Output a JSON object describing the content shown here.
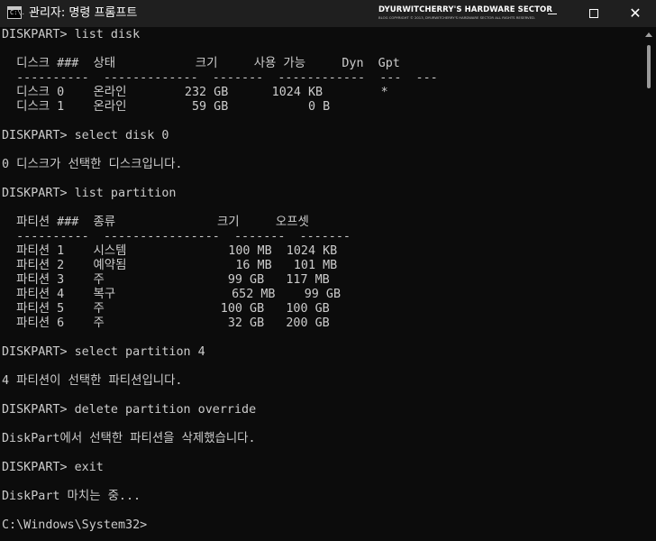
{
  "window": {
    "icon_label": "C:\\.",
    "title": "관리자: 명령 프롬프트",
    "watermark_title": "DYURWITCHERRY'S HARDWARE SECTOR",
    "watermark_sub": "BLOG COPYRIGHT © 2013, DYURWITCHERRY'S HARDWARE SECTOR ALL RIGHTS RESERVED."
  },
  "console": {
    "lines": [
      "DISKPART> list disk",
      "",
      "  디스크 ###  상태           크기     사용 가능     Dyn  Gpt",
      "  ----------  -------------  -------  ------------  ---  ---",
      "  디스크 0    온라인        232 GB      1024 KB        *",
      "  디스크 1    온라인         59 GB           0 B",
      "",
      "DISKPART> select disk 0",
      "",
      "0 디스크가 선택한 디스크입니다.",
      "",
      "DISKPART> list partition",
      "",
      "  파티션 ###  종류              크기     오프셋",
      "  ----------  ----------------  -------  -------",
      "  파티션 1    시스템              100 MB  1024 KB",
      "  파티션 2    예약됨               16 MB   101 MB",
      "  파티션 3    주                 99 GB   117 MB",
      "  파티션 4    복구                652 MB    99 GB",
      "  파티션 5    주                100 GB   100 GB",
      "  파티션 6    주                 32 GB   200 GB",
      "",
      "DISKPART> select partition 4",
      "",
      "4 파티션이 선택한 파티션입니다.",
      "",
      "DISKPART> delete partition override",
      "",
      "DiskPart에서 선택한 파티션을 삭제했습니다.",
      "",
      "DISKPART> exit",
      "",
      "DiskPart 마치는 중...",
      "",
      "C:\\Windows\\System32>"
    ]
  }
}
